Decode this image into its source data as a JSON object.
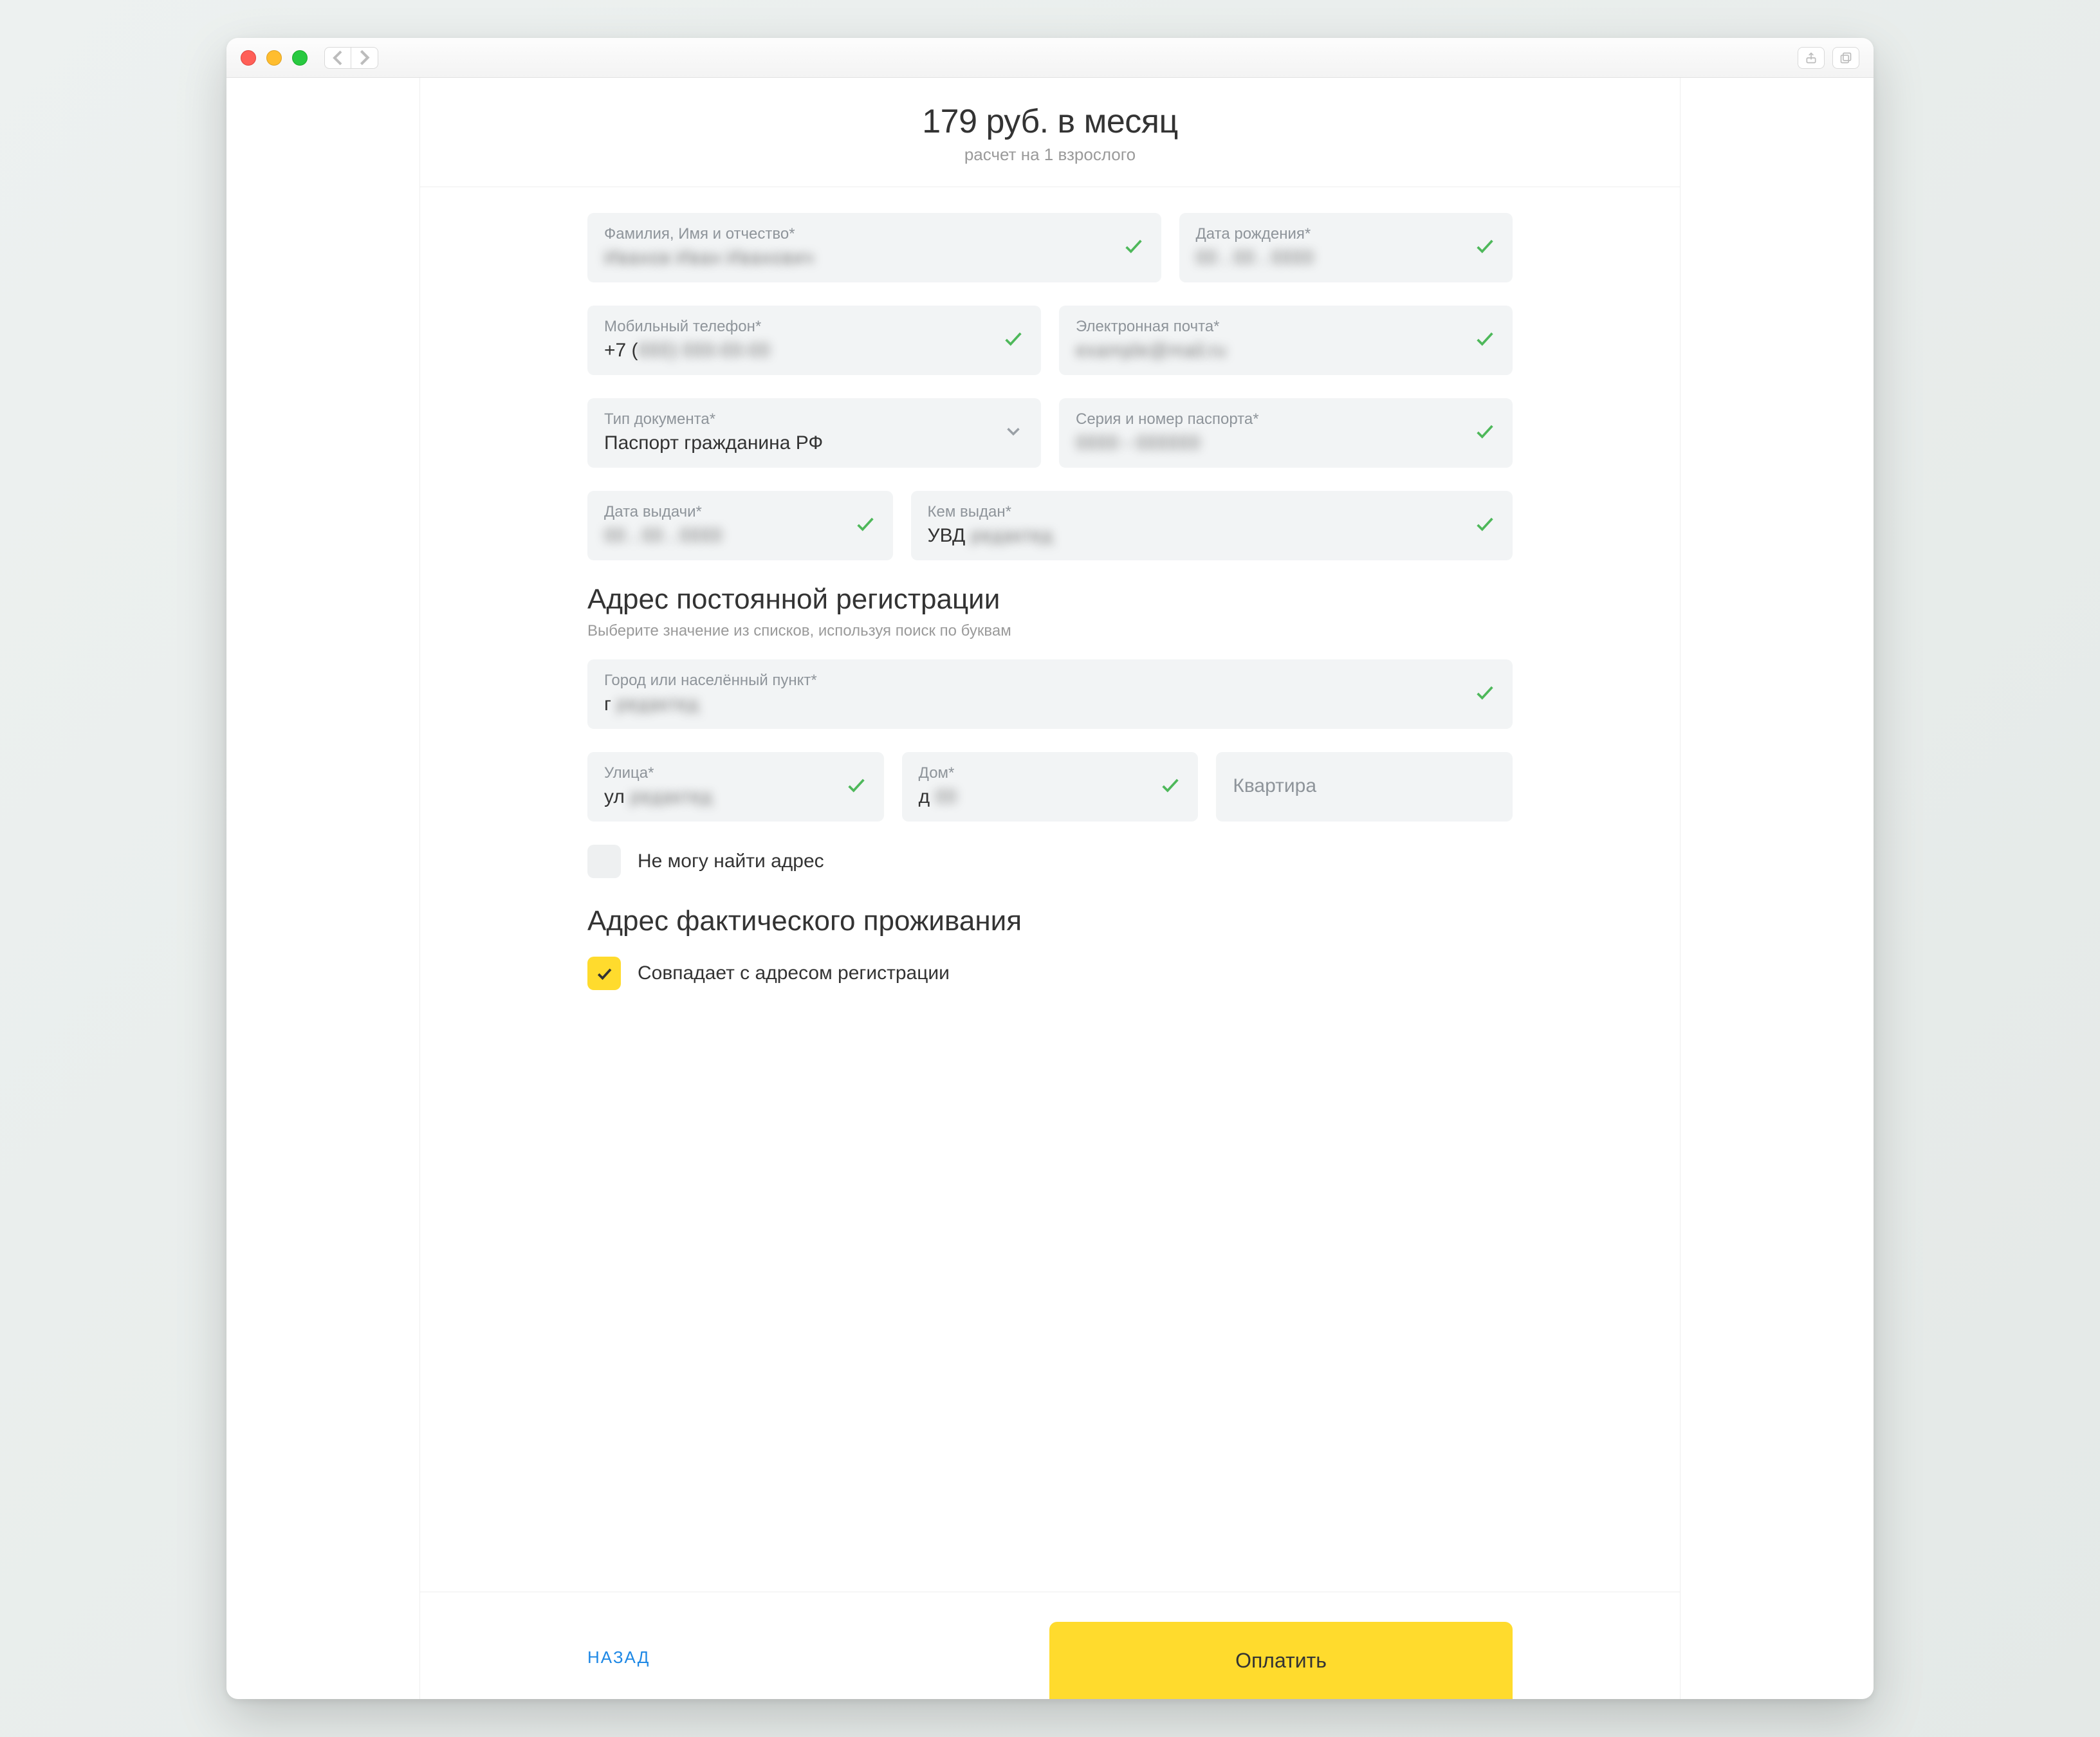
{
  "header": {
    "price": "179 руб. в месяц",
    "subtitle": "расчет на 1 взрослого"
  },
  "fields": {
    "fullname": {
      "label": "Фамилия, Имя и отчество*",
      "value": "Иванов Иван Иванович"
    },
    "dob": {
      "label": "Дата рождения*",
      "value": "00 . 00 . 0000"
    },
    "phone": {
      "label": "Мобильный телефон*",
      "value_prefix": "+7 (",
      "value_blur": "000) 000-00-00"
    },
    "email": {
      "label": "Электронная почта*",
      "value": "example@mail.ru"
    },
    "doctype": {
      "label": "Тип документа*",
      "value": "Паспорт гражданина РФ"
    },
    "passport": {
      "label": "Серия и номер паспорта*",
      "value": "0000 - 000000"
    },
    "issue_date": {
      "label": "Дата выдачи*",
      "value": "00 . 00 . 0000"
    },
    "issued_by": {
      "label": "Кем выдан*",
      "value_prefix": "УВД ",
      "value_blur": "редактед"
    }
  },
  "address": {
    "title": "Адрес постоянной регистрации",
    "subtitle": "Выберите значение из списков, используя поиск по буквам",
    "city": {
      "label": "Город или населённый пункт*",
      "value_prefix": "г ",
      "value_blur": "редактед"
    },
    "street": {
      "label": "Улица*",
      "value_prefix": "ул ",
      "value_blur": "редактед"
    },
    "house": {
      "label": "Дом*",
      "value_prefix": "д ",
      "value_blur": "00"
    },
    "flat": {
      "placeholder": "Квартира"
    },
    "cantfind_label": "Не могу найти адрес"
  },
  "residence": {
    "title": "Адрес фактического проживания",
    "same_label": "Совпадает с адресом регистрации"
  },
  "footer": {
    "back": "НАЗАД",
    "pay": "Оплатить"
  }
}
